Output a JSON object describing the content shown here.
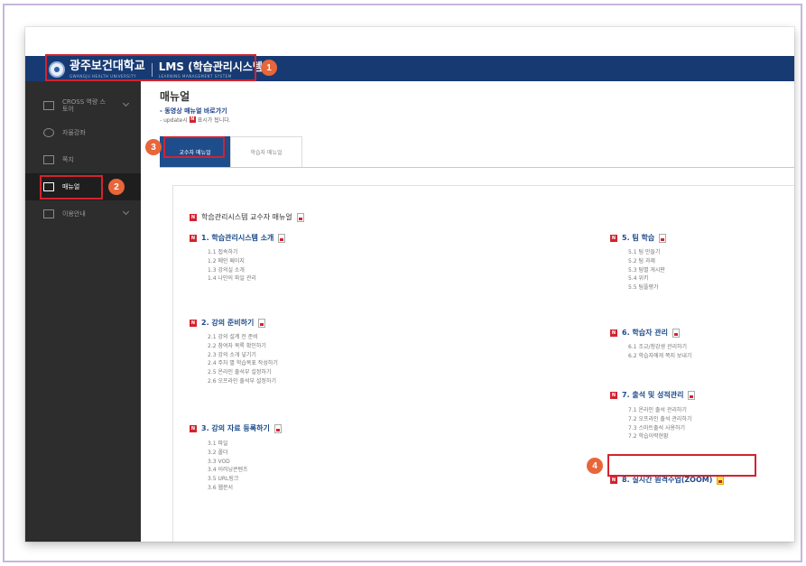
{
  "header": {
    "university_name": "광주보건대학교",
    "university_name_en": "GWANGJU HEALTH UNIVERSITY",
    "system_name": "LMS (학습관리시스템)",
    "system_name_en": "LEARNING MANAGEMENT SYSTEM"
  },
  "callouts": [
    "1",
    "2",
    "3",
    "4"
  ],
  "sidebar": {
    "items": [
      {
        "label": "CROSS 역량 스토어",
        "icon": "store-icon",
        "has_chevron": true
      },
      {
        "label": "자율강좌",
        "icon": "people-icon",
        "has_chevron": false
      },
      {
        "label": "쪽지",
        "icon": "mail-icon",
        "has_chevron": false
      },
      {
        "label": "매뉴얼",
        "icon": "book-icon",
        "has_chevron": false,
        "active": true
      },
      {
        "label": "이용안내",
        "icon": "guide-icon",
        "has_chevron": true
      }
    ]
  },
  "main": {
    "title": "매뉴얼",
    "video_link": "- 동영상 매뉴얼 바로가기",
    "update_prefix": "- update시",
    "update_mark": "N",
    "update_suffix": "표시가 됩니다.",
    "tabs": [
      {
        "label": "교수자 매뉴얼",
        "active": true
      },
      {
        "label": "학습자 매뉴얼",
        "active": false
      }
    ],
    "doc_title": "학습관리시스템 교수자 매뉴얼",
    "new_mark": "N",
    "sections": [
      {
        "title": "1. 학습관리시스템 소개",
        "items": [
          "1.1 접속하기",
          "1.2 메인 페이지",
          "1.3 강의실 소개",
          "1.4 나만의 파일 관리"
        ]
      },
      {
        "title": "2. 강의 준비하기",
        "items": [
          "2.1 강의 설계 전 준비",
          "2.2 참여자 목록 확인하기",
          "2.3 강의 소개 넣기기",
          "2.4 주차 별 학습목표 작성하기",
          "2.5 온라인 출석부 설정하기",
          "2.6 오프라인 출석부 설정하기"
        ]
      },
      {
        "title": "3. 강의 자료 등록하기",
        "items": [
          "3.1 파일",
          "3.2 폴더",
          "3.3 VOD",
          "3.4 이러닝콘텐츠",
          "3.5 URL링크",
          "3.6 웹문서"
        ]
      },
      {
        "title": "5. 팀 학습",
        "items": [
          "5.1 팀 만들기",
          "5.2 팀 과제",
          "5.3 팀별 게시판",
          "5.4 위키",
          "5.5 팀플평가"
        ]
      },
      {
        "title": "6. 학습자 관리",
        "items": [
          "6.1 조교/청강생 관리하기",
          "6.2 학습자에게 쪽지 보내기"
        ]
      },
      {
        "title": "7. 출석 및 성적관리",
        "items": [
          "7.1 온라인 출석 관리하기",
          "7.2 오프라인 출석 관리하기",
          "7.3 스마트출석 사용하기",
          "7.2 학습이력현황"
        ]
      },
      {
        "title": "8. 실시간 원격수업(ZOOM)",
        "items": []
      }
    ]
  },
  "colors": {
    "topbar": "#173a73",
    "sidebar": "#2d2d2d",
    "accent_blue": "#1e4d8c",
    "highlight_red": "#d3232f",
    "badge_orange": "#e8663a",
    "pdf_highlight": "#f6e43a"
  }
}
